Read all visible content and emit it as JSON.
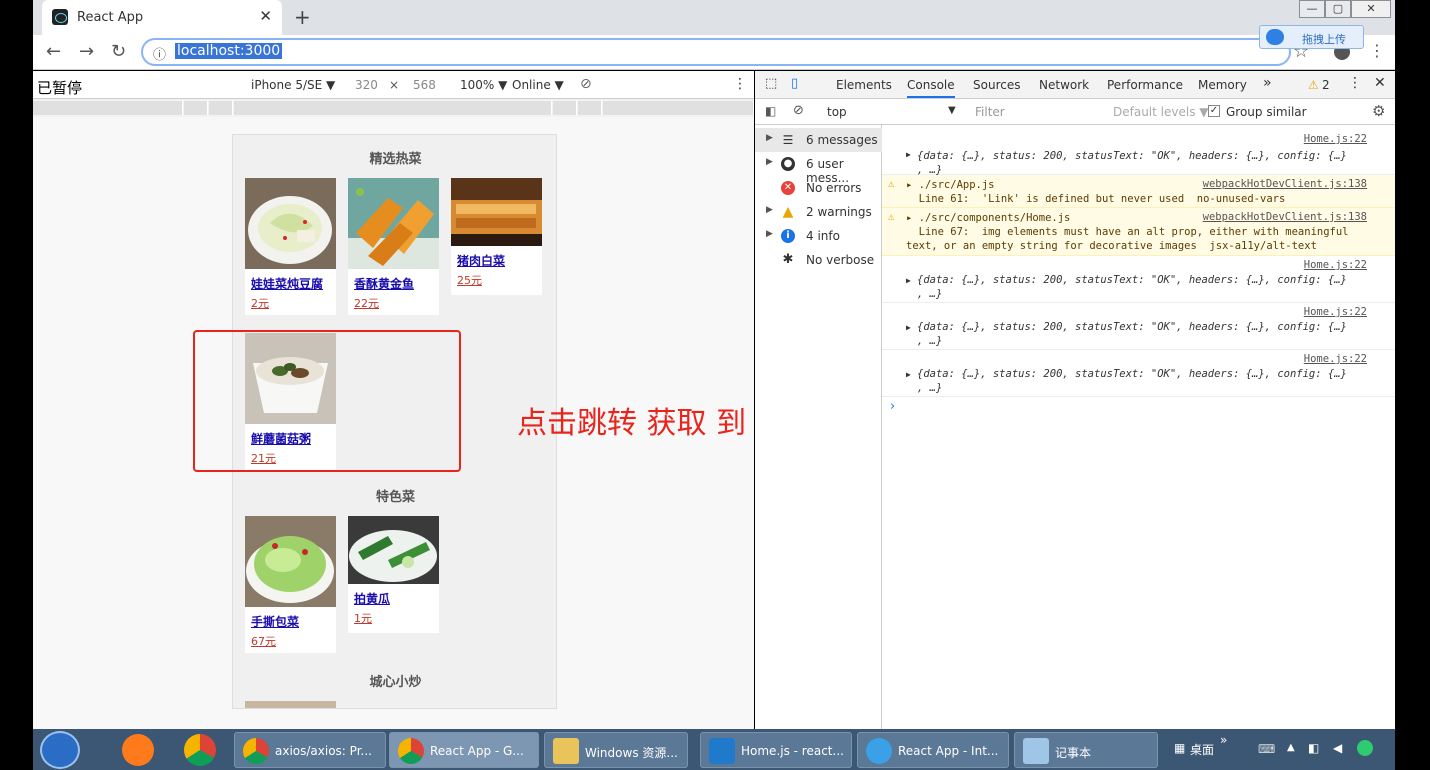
{
  "browser": {
    "tab_title": "React App",
    "tab_close": "✕",
    "new_tab": "+",
    "url": "localhost:3000",
    "win_min": "—",
    "win_max": "▢",
    "win_close": "✕"
  },
  "baidu_ext": {
    "label": "拖拽上传"
  },
  "device_toolbar": {
    "paused_label": "已暂停",
    "device": "iPhone 5/SE ▼",
    "width": "320",
    "times": "×",
    "height": "568",
    "zoom": "100% ▼",
    "network": "Online ▼"
  },
  "page": {
    "sections": [
      {
        "title": "精选热菜",
        "items": [
          {
            "name": "娃娃菜炖豆腐",
            "price": "2元"
          },
          {
            "name": "香酥黄金鱼",
            "price": "22元"
          },
          {
            "name": "猪肉白菜",
            "price": "25元"
          },
          {
            "name": "鲜蘑菌菇粥",
            "price": "21元"
          }
        ]
      },
      {
        "title": "特色菜",
        "items": [
          {
            "name": "手撕包菜",
            "price": "67元"
          },
          {
            "name": "拍黄瓜",
            "price": "1元"
          }
        ]
      },
      {
        "title": "城心小炒",
        "items": []
      }
    ]
  },
  "annotation": "点击跳转  获取 到 aid",
  "devtools": {
    "tabs": [
      "Elements",
      "Console",
      "Sources",
      "Network",
      "Performance",
      "Memory"
    ],
    "more": "»",
    "warn_count": "2",
    "context": "top",
    "filter_placeholder": "Filter",
    "levels": "Default levels ▼",
    "group_similar": "Group similar",
    "sidebar": [
      {
        "label": "6 messages",
        "icon": "list-icon"
      },
      {
        "label": "6 user mess...",
        "icon": "user-icon"
      },
      {
        "label": "No errors",
        "icon": "error-icon"
      },
      {
        "label": "2 warnings",
        "icon": "warning-icon"
      },
      {
        "label": "4 info",
        "icon": "info-icon"
      },
      {
        "label": "No verbose",
        "icon": "bug-icon"
      }
    ],
    "messages": [
      {
        "type": "log",
        "source": "Home.js:22",
        "text": "{data: {…}, status: 200, statusText: \"OK\", headers: {…}, config: {…}",
        "cont": ", …}"
      },
      {
        "type": "warn",
        "source": "webpackHotDevClient.js:138",
        "text": "▸ ./src/App.js",
        "cont": "  Line 61:  'Link' is defined but never used  no-unused-vars"
      },
      {
        "type": "warn",
        "source": "webpackHotDevClient.js:138",
        "text": "▸ ./src/components/Home.js",
        "cont": "  Line 67:  img elements must have an alt prop, either with meaningful",
        "cont2": "text, or an empty string for decorative images  jsx-a11y/alt-text"
      },
      {
        "type": "log",
        "source": "Home.js:22",
        "text": "{data: {…}, status: 200, statusText: \"OK\", headers: {…}, config: {…}",
        "cont": ", …}"
      },
      {
        "type": "log",
        "source": "Home.js:22",
        "text": "{data: {…}, status: 200, statusText: \"OK\", headers: {…}, config: {…}",
        "cont": ", …}"
      },
      {
        "type": "log",
        "source": "Home.js:22",
        "text": "{data: {…}, status: 200, statusText: \"OK\", headers: {…}, config: {…}",
        "cont": ", …}"
      }
    ],
    "prompt": "›"
  },
  "taskbar": {
    "items": [
      {
        "label": "axios/axios: Pr..."
      },
      {
        "label": "React App - G..."
      },
      {
        "label": "Windows 资源..."
      },
      {
        "label": "Home.js - react..."
      },
      {
        "label": "React App - Int..."
      },
      {
        "label": "记事本"
      }
    ],
    "desktop": "桌面"
  }
}
